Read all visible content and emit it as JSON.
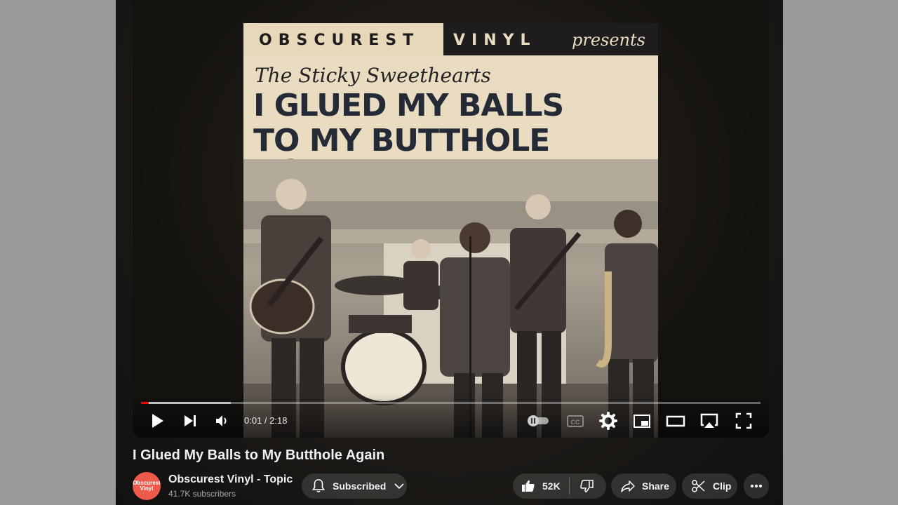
{
  "cover": {
    "brand_left": "OBSCUREST",
    "brand_right": "VINYL",
    "presents": "presents",
    "band": "The Sticky Sweethearts",
    "song_line1": "I GLUED MY BALLS",
    "song_line2": "TO MY BUTTHOLE AGAIN"
  },
  "player": {
    "time_display": "0:01 / 2:18",
    "progress_played_fraction": 0.012,
    "progress_buffered_fraction": 0.145
  },
  "video": {
    "title": "I Glued My Balls to My Butthole Again"
  },
  "channel": {
    "name": "Obscurest Vinyl - Topic",
    "subscribers": "41.7K subscribers",
    "avatar_text": "Obscurest Vinyl",
    "avatar_color": "#ee5a4a"
  },
  "actions": {
    "subscribed_label": "Subscribed",
    "like_count": "52K",
    "share_label": "Share",
    "clip_label": "Clip"
  },
  "colors": {
    "progress": "#ff0000",
    "background": "#9b9b9b"
  }
}
